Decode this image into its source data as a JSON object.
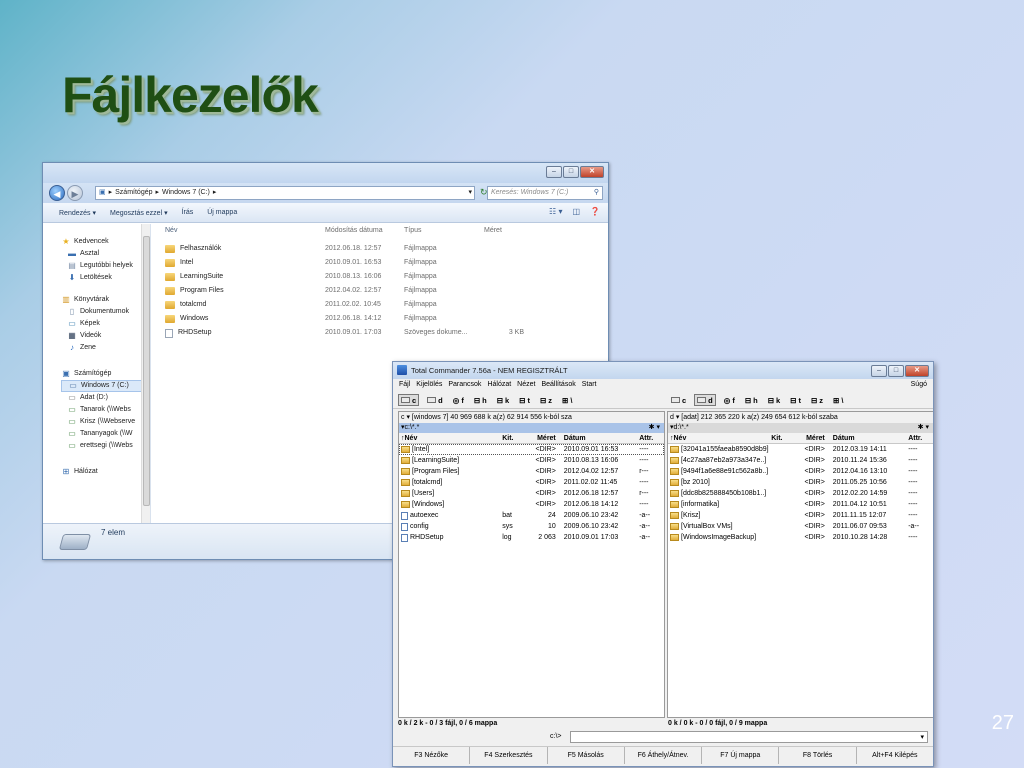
{
  "slide": {
    "title": "Fájlkezelők",
    "page_number": "27"
  },
  "explorer": {
    "address": {
      "crumb1": "Számítógép",
      "crumb2": "Windows 7 (C:)"
    },
    "search_placeholder": "Keresés: Windows 7 (C:)",
    "toolbar": {
      "organize": "Rendezés ▾",
      "share": "Megosztás ezzel ▾",
      "burn": "Írás",
      "new_folder": "Új mappa"
    },
    "nav": {
      "favorites": "Kedvencek",
      "desktop": "Asztal",
      "recent": "Legutóbbi helyek",
      "downloads": "Letöltések",
      "libraries": "Könyvtárak",
      "documents": "Dokumentumok",
      "pictures": "Képek",
      "videos": "Videók",
      "music": "Zene",
      "computer": "Számítógép",
      "drive_c": "Windows 7 (C:)",
      "drive_d": "Adat (D:)",
      "net1": "Tanarok (\\\\Webs",
      "net2": "Krisz (\\\\Webserve",
      "net3": "Tananyagok (\\\\W",
      "net4": "erettsegi (\\\\Webs",
      "network": "Hálózat"
    },
    "columns": {
      "name": "Név",
      "date": "Módosítás dátuma",
      "type": "Típus",
      "size": "Méret"
    },
    "files": [
      {
        "name": "Felhasználók",
        "date": "2012.06.18. 12:57",
        "type": "Fájlmappa",
        "size": ""
      },
      {
        "name": "Intel",
        "date": "2010.09.01. 16:53",
        "type": "Fájlmappa",
        "size": ""
      },
      {
        "name": "LearningSuite",
        "date": "2010.08.13. 16:06",
        "type": "Fájlmappa",
        "size": ""
      },
      {
        "name": "Program Files",
        "date": "2012.04.02. 12:57",
        "type": "Fájlmappa",
        "size": ""
      },
      {
        "name": "totalcmd",
        "date": "2011.02.02. 10:45",
        "type": "Fájlmappa",
        "size": ""
      },
      {
        "name": "Windows",
        "date": "2012.06.18. 14:12",
        "type": "Fájlmappa",
        "size": ""
      },
      {
        "name": "RHDSetup",
        "date": "2010.09.01. 17:03",
        "type": "Szöveges dokume...",
        "size": "3 KB"
      }
    ],
    "status": "7 elem"
  },
  "tc": {
    "title": "Total Commander 7.56a - NEM REGISZTRÁLT",
    "menu": {
      "file": "Fájl",
      "mark": "Kijelölés",
      "commands": "Parancsok",
      "network": "Hálózat",
      "view": "Nézet",
      "config": "Beállítások",
      "start": "Start",
      "help": "Súgó"
    },
    "drives": [
      "c",
      "d",
      "f",
      "h",
      "k",
      "t",
      "z",
      "\\"
    ],
    "left": {
      "drive_info": "c  ▾  [windows 7]  40 969 688 k a(z) 62 914 556 k-ból sza",
      "path": "▾c:\\*.*",
      "header": {
        "name": "↑Név",
        "ext": "Kit.",
        "size": "Méret",
        "date": "Dátum",
        "attr": "Attr."
      },
      "rows": [
        {
          "name": "[Intel]",
          "ext": "",
          "size": "<DIR>",
          "date": "2010.09.01 16:53",
          "attr": "----"
        },
        {
          "name": "[LearningSuite]",
          "ext": "",
          "size": "<DIR>",
          "date": "2010.08.13 16:06",
          "attr": "----"
        },
        {
          "name": "[Program Files]",
          "ext": "",
          "size": "<DIR>",
          "date": "2012.04.02 12:57",
          "attr": "r---"
        },
        {
          "name": "[totalcmd]",
          "ext": "",
          "size": "<DIR>",
          "date": "2011.02.02 11:45",
          "attr": "----"
        },
        {
          "name": "[Users]",
          "ext": "",
          "size": "<DIR>",
          "date": "2012.06.18 12:57",
          "attr": "r---"
        },
        {
          "name": "[Windows]",
          "ext": "",
          "size": "<DIR>",
          "date": "2012.06.18 14:12",
          "attr": "----"
        },
        {
          "name": "autoexec",
          "ext": "bat",
          "size": "24",
          "date": "2009.06.10 23:42",
          "attr": "-a--"
        },
        {
          "name": "config",
          "ext": "sys",
          "size": "10",
          "date": "2009.06.10 23:42",
          "attr": "-a--"
        },
        {
          "name": "RHDSetup",
          "ext": "log",
          "size": "2 063",
          "date": "2010.09.01 17:03",
          "attr": "-a--"
        }
      ],
      "status": "0 k / 2 k - 0 / 3 fájl, 0 / 6 mappa"
    },
    "right": {
      "drive_info": "d  ▾  [adat]  212 365 220 k a(z) 249 654 612 k-ból szaba",
      "path": "▾d:\\*.*",
      "header": {
        "name": "↑Név",
        "ext": "Kit.",
        "size": "Méret",
        "date": "Dátum",
        "attr": "Attr."
      },
      "rows": [
        {
          "name": "[32041a155faeab8590d8b9]",
          "ext": "",
          "size": "<DIR>",
          "date": "2012.03.19 14:11",
          "attr": "----"
        },
        {
          "name": "[4c27aa87eb2a973a347e..]",
          "ext": "",
          "size": "<DIR>",
          "date": "2010.11.24 15:36",
          "attr": "----"
        },
        {
          "name": "[9494f1a6e88e91c562a8b..]",
          "ext": "",
          "size": "<DIR>",
          "date": "2012.04.16 13:10",
          "attr": "----"
        },
        {
          "name": "[bz 2010]",
          "ext": "",
          "size": "<DIR>",
          "date": "2011.05.25 10:56",
          "attr": "----"
        },
        {
          "name": "[ddc8b825888450b108b1..]",
          "ext": "",
          "size": "<DIR>",
          "date": "2012.02.20 14:59",
          "attr": "----"
        },
        {
          "name": "[informatika]",
          "ext": "",
          "size": "<DIR>",
          "date": "2011.04.12 10:51",
          "attr": "----"
        },
        {
          "name": "[Krisz]",
          "ext": "",
          "size": "<DIR>",
          "date": "2011.11.15 12:07",
          "attr": "----"
        },
        {
          "name": "[VirtualBox VMs]",
          "ext": "",
          "size": "<DIR>",
          "date": "2011.06.07 09:53",
          "attr": "-a--"
        },
        {
          "name": "[WindowsImageBackup]",
          "ext": "",
          "size": "<DIR>",
          "date": "2010.10.28 14:28",
          "attr": "----"
        }
      ],
      "status": "0 k / 0 k - 0 / 0 fájl, 0 / 9 mappa"
    },
    "cmd_label": "c:\\>",
    "fkeys": [
      "F3 Nézőke",
      "F4 Szerkesztés",
      "F5 Másolás",
      "F6 Áthely/Átnev.",
      "F7 Új mappa",
      "F8 Törlés",
      "Alt+F4 Kilépés"
    ]
  }
}
